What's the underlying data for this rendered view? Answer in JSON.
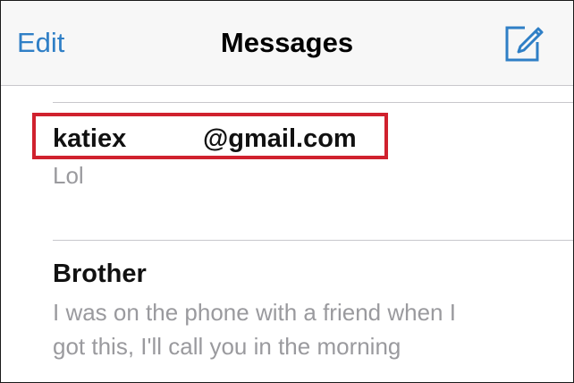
{
  "navbar": {
    "edit_label": "Edit",
    "title": "Messages",
    "compose_icon": "compose-icon"
  },
  "conversations": [
    {
      "sender_prefix": "katiex",
      "sender_domain": "@gmail.com",
      "preview": "Lol"
    },
    {
      "sender": "Brother",
      "preview_line1": "I was on the phone with a friend when I",
      "preview_line2": "got this, I'll call you in the morning"
    }
  ],
  "colors": {
    "accent": "#2f7fc6",
    "highlight": "#d0212e",
    "preview_text": "#9a9a9e",
    "separator": "#c8c7cc"
  }
}
